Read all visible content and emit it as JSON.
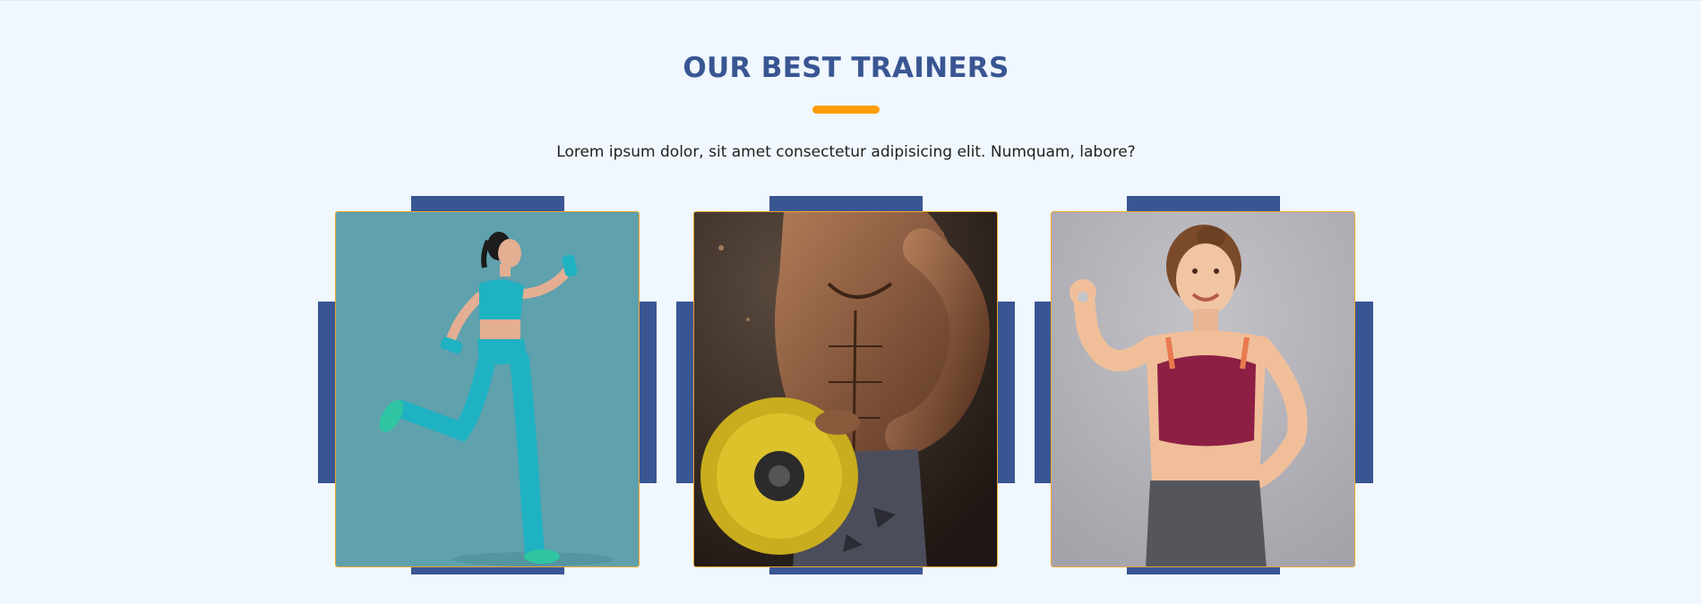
{
  "section": {
    "title": "OUR BEST TRAINERS",
    "subtitle": "Lorem ipsum dolor, sit amet consectetur adipisicing elit. Numquam, labore?"
  },
  "colors": {
    "background": "#f0f7fe",
    "title": "#395693",
    "accent": "#fd9c0a",
    "frame": "#395693",
    "photo_border": "#f0a530"
  },
  "trainers": [
    {
      "photo": "female runner with dumbbells on teal background"
    },
    {
      "photo": "muscular man holding yellow weight plate"
    },
    {
      "photo": "smiling woman in sports bra making ok sign"
    }
  ]
}
